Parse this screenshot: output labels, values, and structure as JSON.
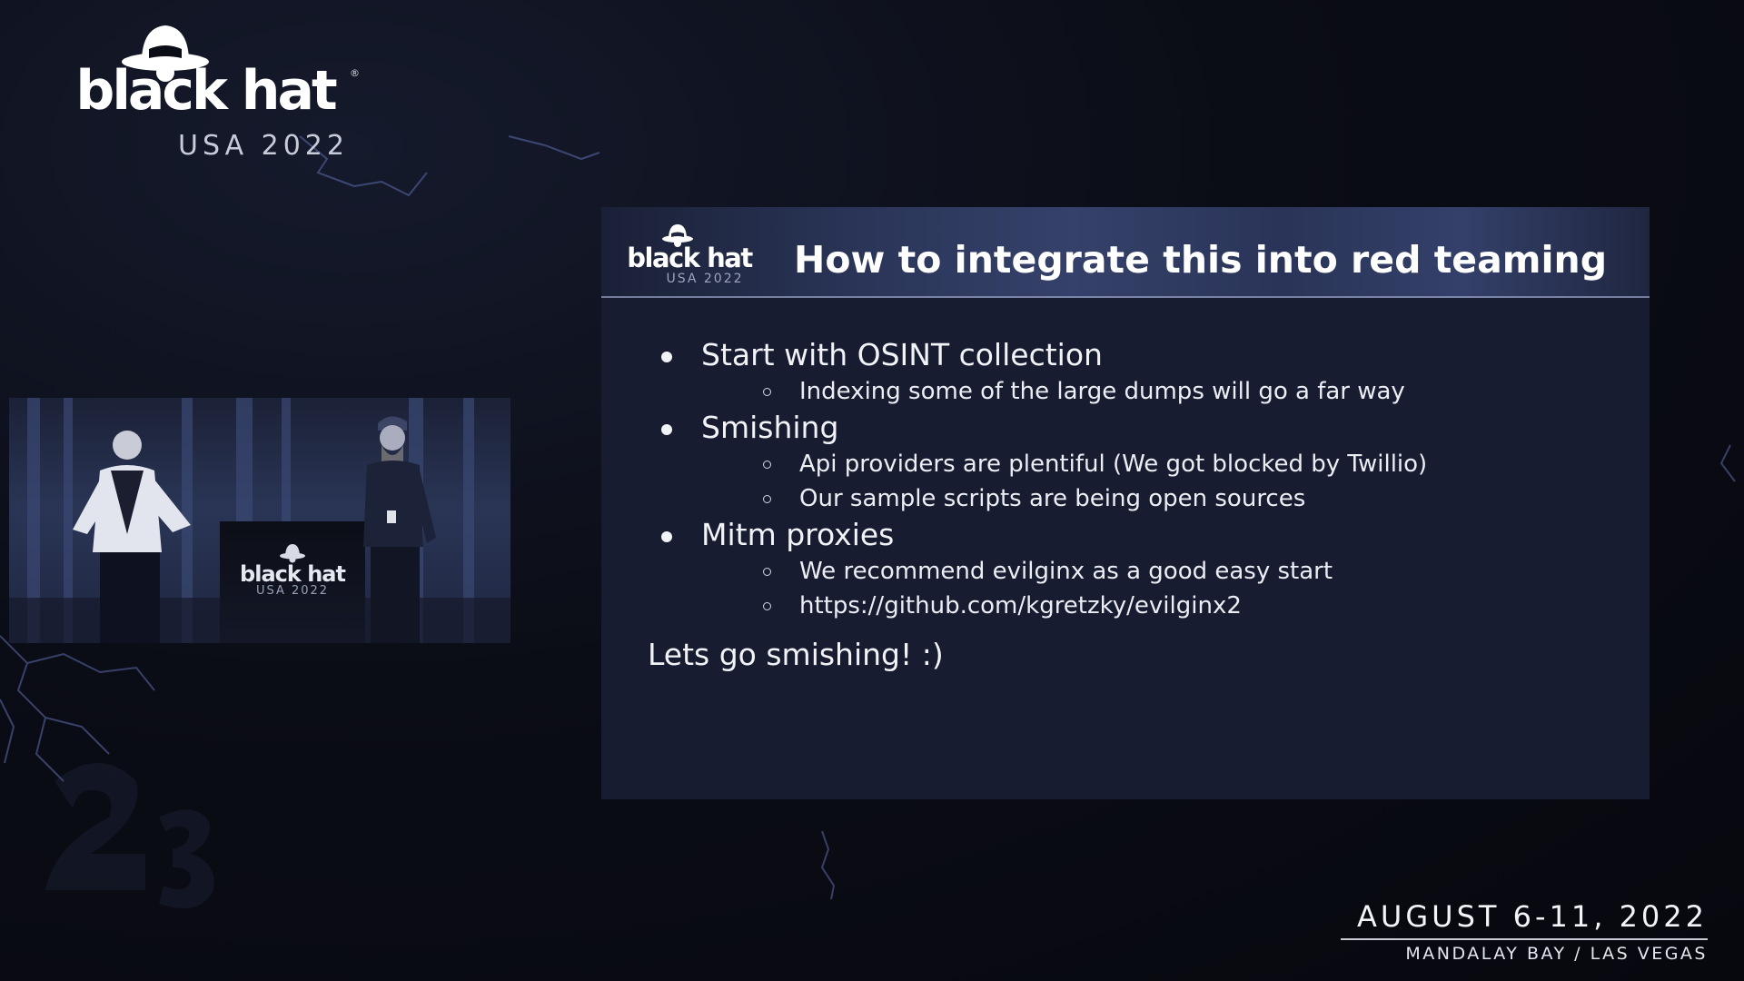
{
  "brand": {
    "name": "black hat",
    "edition": "USA 2022",
    "registered_mark": "®",
    "logo_icon": "black-hat-spy-icon"
  },
  "stage_feed": {
    "podium_logo_name": "black hat",
    "podium_logo_edition": "USA 2022"
  },
  "slide": {
    "logo_name": "black hat",
    "logo_edition": "USA 2022",
    "title": "How to integrate this into red teaming",
    "bullets": [
      {
        "text": "Start with OSINT collection",
        "sub": [
          "Indexing some of the large dumps will go a far way"
        ]
      },
      {
        "text": "Smishing",
        "sub": [
          "Api providers are plentiful (We got blocked by Twillio)",
          "Our sample scripts are being open sources"
        ]
      },
      {
        "text": "Mitm proxies",
        "sub": [
          "We recommend evilginx as a good easy start",
          "https://github.com/kgretzky/evilginx2"
        ]
      }
    ],
    "closing": "Lets go smishing! :)"
  },
  "event": {
    "dates": "AUGUST 6-11, 2022",
    "venue": "MANDALAY BAY / LAS VEGAS"
  },
  "colors": {
    "background": "#0b0d16",
    "slide_body": "#171c30",
    "slide_header_accent": "#35416a",
    "text": "#f2f3f7",
    "lightning": "#6e7cc0"
  }
}
